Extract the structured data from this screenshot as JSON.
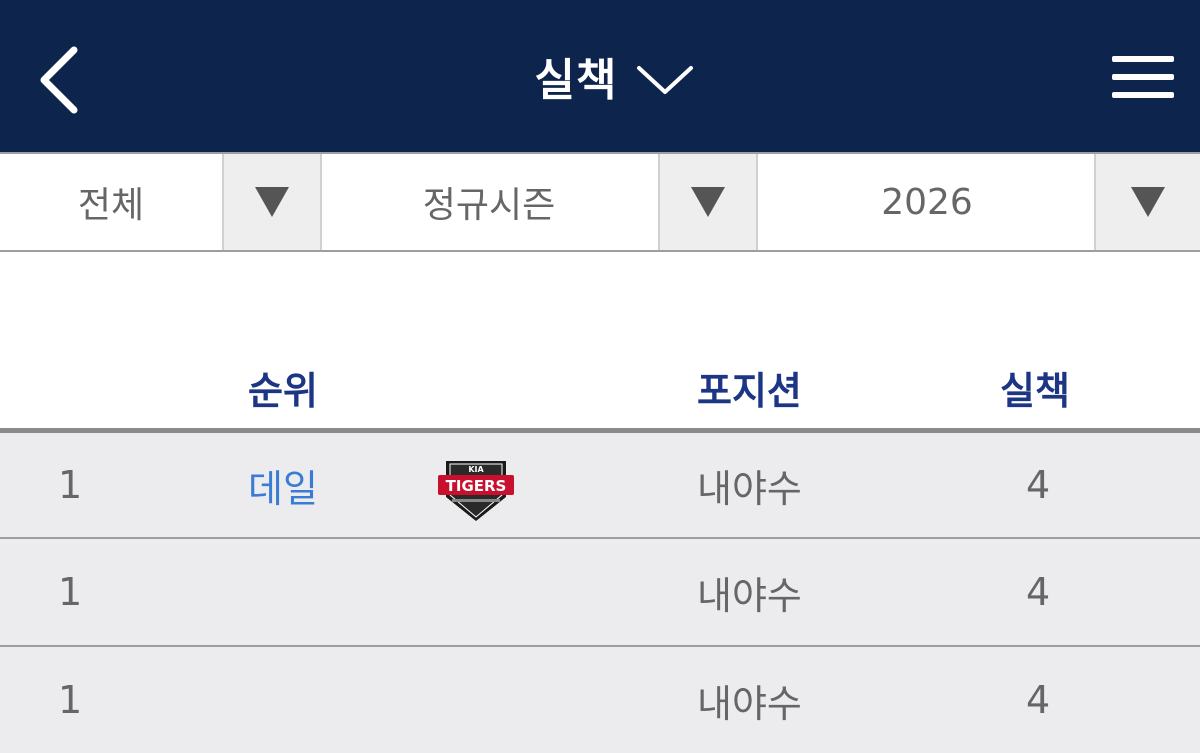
{
  "header": {
    "title": "실책",
    "back_icon": "chevron-left-icon",
    "dropdown_icon": "chevron-down-icon",
    "menu_icon": "hamburger-menu-icon"
  },
  "filters": [
    {
      "value": "전체"
    },
    {
      "value": "정규시즌"
    },
    {
      "value": "2026"
    }
  ],
  "columns": {
    "rank": "순위",
    "position": "포지션",
    "errors": "실책"
  },
  "rows": [
    {
      "rank": "1",
      "name": "데일",
      "team_logo_text": "TIGERS",
      "team_logo_brand": "KIA",
      "position": "내야수",
      "errors": "4"
    },
    {
      "rank": "1",
      "name": "",
      "position": "내야수",
      "errors": "4"
    },
    {
      "rank": "1",
      "name": "",
      "position": "내야수",
      "errors": "4"
    }
  ],
  "colors": {
    "header_bg": "#0d254d",
    "column_header": "#1c3584",
    "player_link": "#3a7bd5",
    "row_bg": "#ececee"
  }
}
